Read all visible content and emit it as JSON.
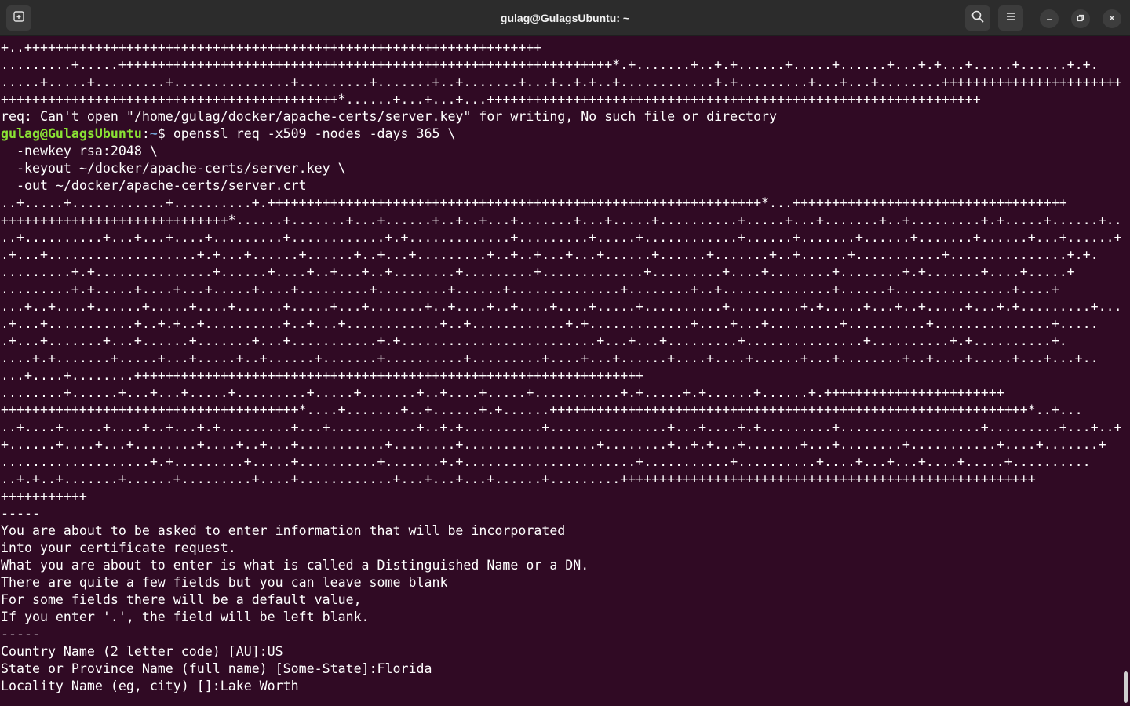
{
  "window": {
    "title": "gulag@GulagsUbuntu: ~"
  },
  "titlebar_icons": {
    "new_tab": "new-tab-icon",
    "search": "search-icon",
    "menu": "hamburger-menu-icon",
    "minimize": "minimize-icon",
    "maximize": "restore-icon",
    "close": "close-icon"
  },
  "colors": {
    "background": "#300a24",
    "text": "#ffffff",
    "prompt_user": "#8ae234",
    "prompt_path": "#729fcf",
    "titlebar": "#2c2c2c"
  },
  "prompt": {
    "user_host": "gulag@GulagsUbuntu",
    "separator": ":",
    "path": "~",
    "symbol": "$ ",
    "command": "openssl req -x509 -nodes -days 365 \\"
  },
  "lines_before_prompt": [
    "+..++++++++++++++++++++++++++++++++++++++++++++++++++++++++++++++++++",
    ".........+.....+++++++++++++++++++++++++++++++++++++++++++++++++++++++++++++++*.+.......+..+.+......+.....+......+...+.+...+.....+......+.+.",
    ".....+.....+.........+...............+.........+.......+..+.......+...+..+.+..+............+.+.........+...+...+........+++++++++++++++++++++++",
    "+++++++++++++++++++++++++++++++++++++++++++*......+...+...+...+++++++++++++++++++++++++++++++++++++++++++++++++++++++++++++++",
    "req: Can't open \"/home/gulag/docker/apache-certs/server.key\" for writing, No such file or directory"
  ],
  "lines_after_prompt": [
    "  -newkey rsa:2048 \\",
    "  -keyout ~/docker/apache-certs/server.key \\",
    "  -out ~/docker/apache-certs/server.crt",
    "..+.....+............+..........+.+++++++++++++++++++++++++++++++++++++++++++++++++++++++++++++++*...+++++++++++++++++++++++++++++++++++",
    "+++++++++++++++++++++++++++++*......+.......+...+......+..+..+...+.......+...+.....+..........+.....+...+.......+..+.........+.+.....+......+.........",
    "..+..........+...+...+....+.........+............+.+.............+.........+.....+............+......+.......+......+.......+......+...+......+..+.",
    ".+...+...................+.+...+......+......+..+...+.........+..+..+...+...+......+......+.......+..+......+...........+...............+.+.",
    ".........+.+...............+......+....+..+...+..+........+.........+.............+.........+....+........+........+.+.......+....+.....+",
    ".........+.+.....+....+...+.....+....+.........+.........+......+..............+........+..+..............+......+...............+....+",
    "...+..+....+......+.....+....+......+.....+...+.......+..+....+..+....+....+.....+..........+.........+.+.....+...+..+.....+...+.+.........+.....",
    ".+...+...........+..+.+..+..........+..+...+............+..+............+.+.............+....+...+.........+..........+...............+.....",
    ".+...+.......+...+......+.......+...+...........+.+.........................+...+...+.........+...............+..........+.+..........+.",
    "....+.+.......+.....+...+.....+..+......+.......+..........+.........+....+...+......+....+....+......+...+........+..+....+.....+...+...+..",
    "...+....+........+++++++++++++++++++++++++++++++++++++++++++++++++++++++++++++++++",
    "........+......+...+...+.....+.........+.....+.......+..+....+.....+...........+.+.....+.+......+......+.+++++++++++++++++++++++",
    "++++++++++++++++++++++++++++++++++++++*....+.......+..+......+.+......+++++++++++++++++++++++++++++++++++++++++++++++++++++++++++++*..+...",
    "..+....+.....+....+..+...+.+.........+...+...........+..+.+..........+...............+...+....+.+.........+..................+.........+...+..+...",
    "+......+....+...+........+....+..+...+...........+........+.................+........+..+.+...+.......+...+........+...........+....+.......+",
    "...................+.+.........+.....+..........+.......+.+......................+...........+..........+....+...+...+....+.....+..........",
    "..+.+..+.......+......+.........+....+............+...+...+...+......+.........+++++++++++++++++++++++++++++++++++++++++++++++++++++",
    "+++++++++++",
    "-----",
    "You are about to be asked to enter information that will be incorporated",
    "into your certificate request.",
    "What you are about to enter is what is called a Distinguished Name or a DN.",
    "There are quite a few fields but you can leave some blank",
    "For some fields there will be a default value,",
    "If you enter '.', the field will be left blank.",
    "-----",
    "Country Name (2 letter code) [AU]:US",
    "State or Province Name (full name) [Some-State]:Florida",
    "Locality Name (eg, city) []:Lake Worth"
  ]
}
